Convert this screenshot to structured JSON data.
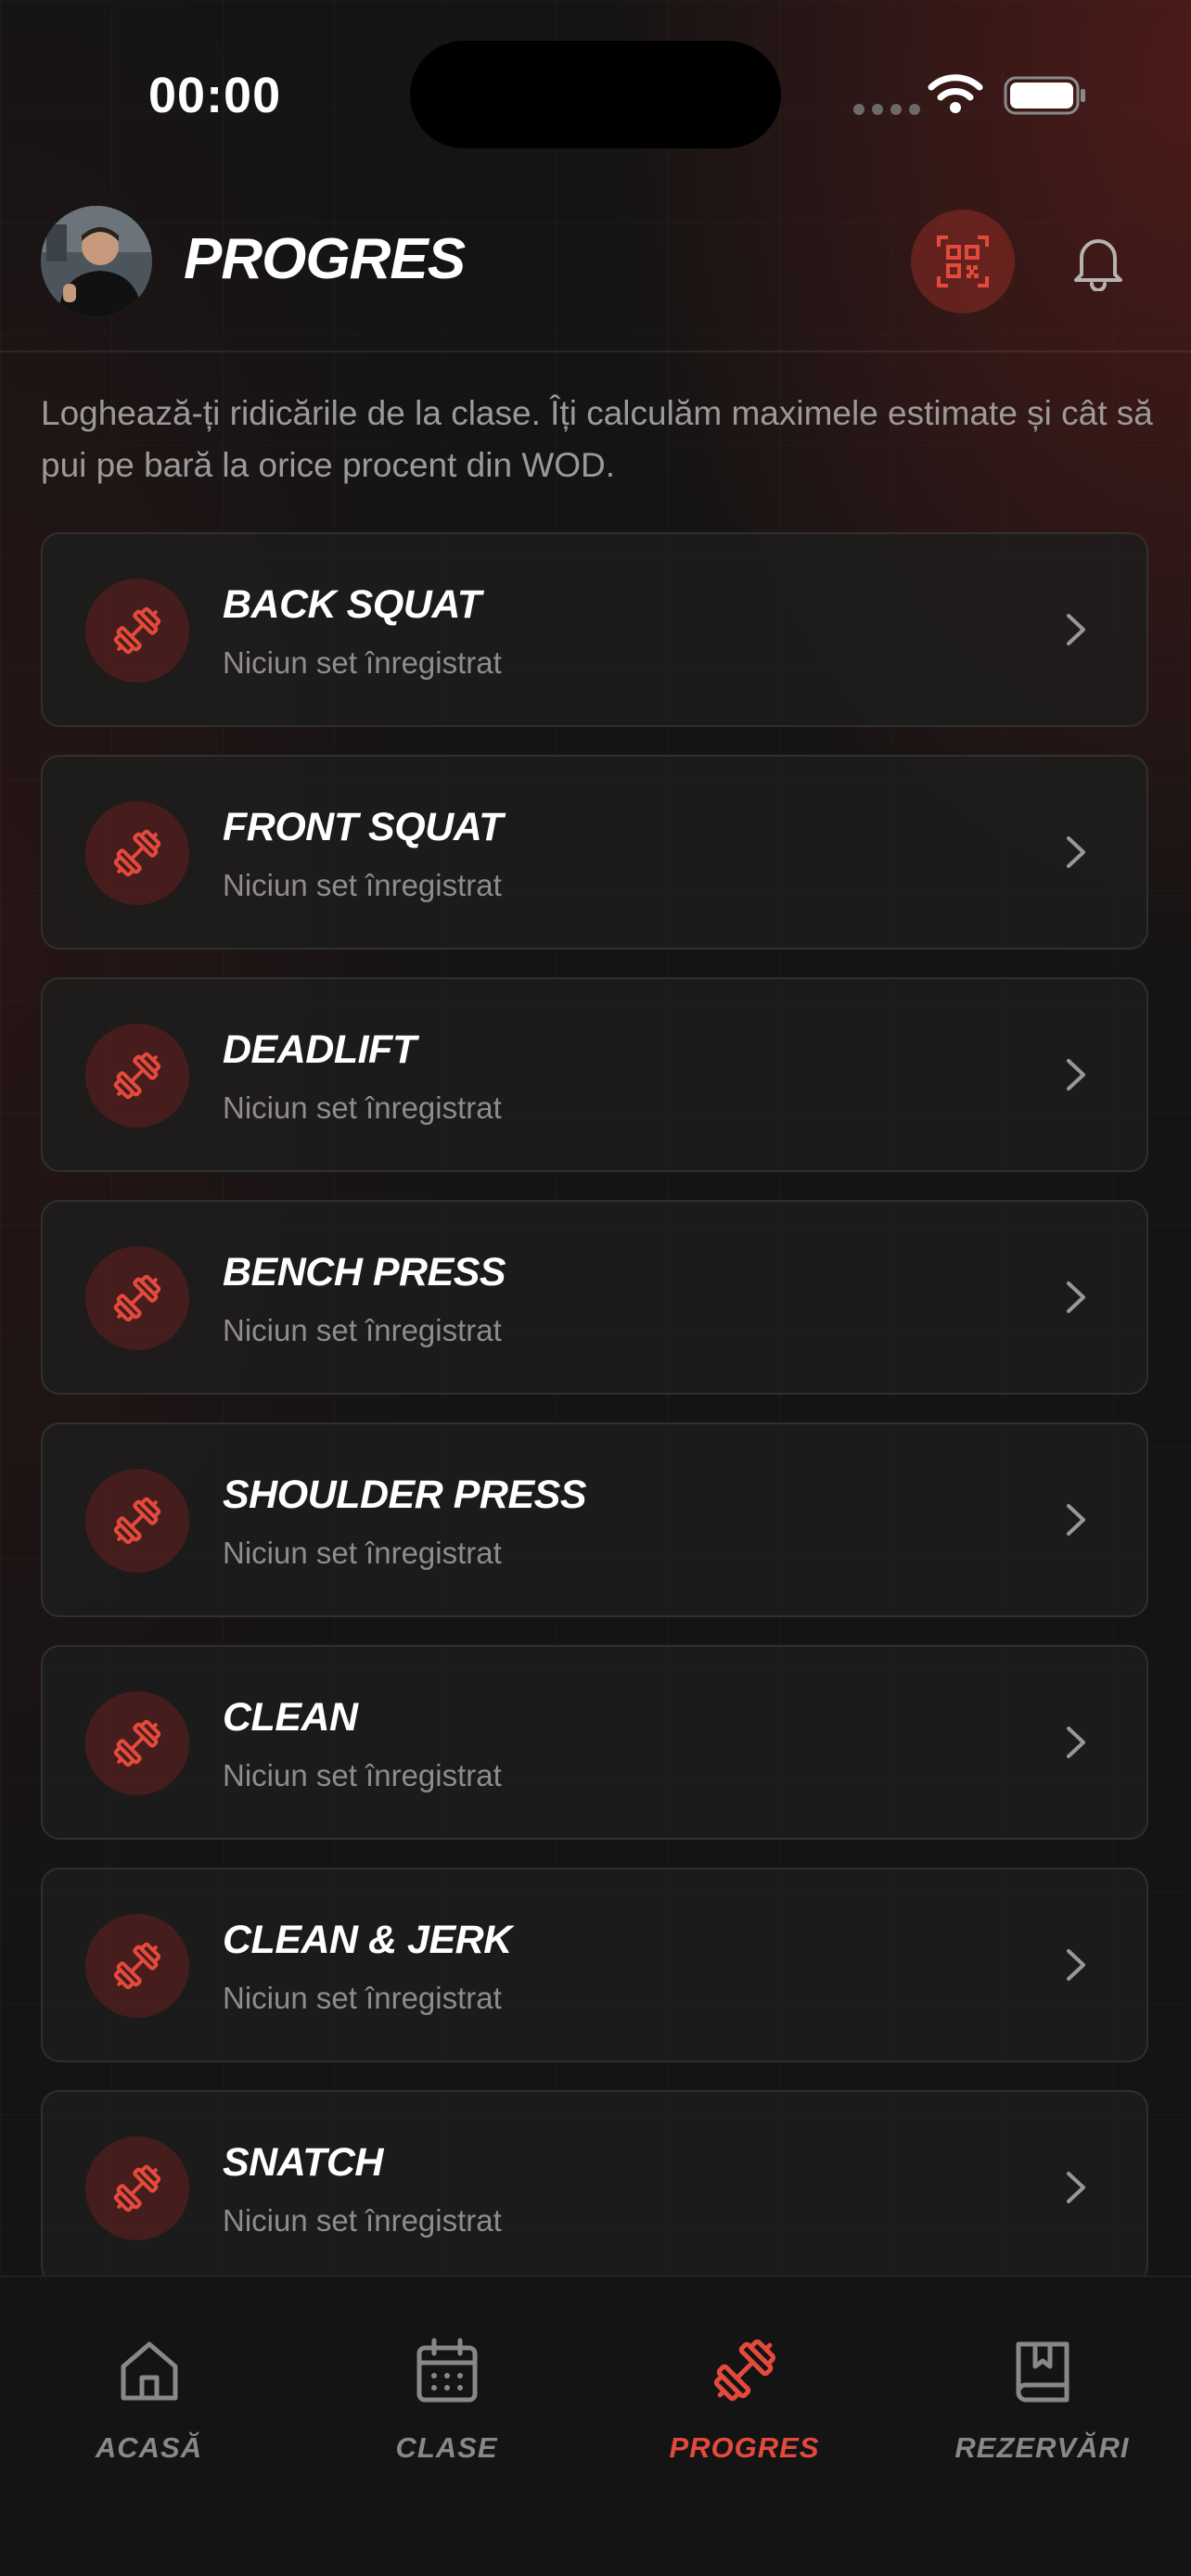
{
  "status_bar": {
    "time": "00:00"
  },
  "header": {
    "title": "PROGRES",
    "avatar_icon": "user-avatar",
    "qr_icon": "qr-code-icon",
    "bell_icon": "bell-icon"
  },
  "intro_text": "Loghează-ți ridicările de la clase. Îți calculăm maximele estimate și cât să pui pe bară la orice procent din WOD.",
  "lifts": [
    {
      "name": "BACK SQUAT",
      "status": "Niciun set înregistrat"
    },
    {
      "name": "FRONT SQUAT",
      "status": "Niciun set înregistrat"
    },
    {
      "name": "DEADLIFT",
      "status": "Niciun set înregistrat"
    },
    {
      "name": "BENCH PRESS",
      "status": "Niciun set înregistrat"
    },
    {
      "name": "SHOULDER PRESS",
      "status": "Niciun set înregistrat"
    },
    {
      "name": "CLEAN",
      "status": "Niciun set înregistrat"
    },
    {
      "name": "CLEAN & JERK",
      "status": "Niciun set înregistrat"
    },
    {
      "name": "SNATCH",
      "status": "Niciun set înregistrat"
    }
  ],
  "tab_bar": {
    "home": "ACASĂ",
    "classes": "CLASE",
    "progress": "PROGRES",
    "bookings": "REZERVĂRI",
    "active": "progress"
  },
  "colors": {
    "accent": "#e44a3c",
    "background": "#151414",
    "muted": "#8a8887"
  }
}
